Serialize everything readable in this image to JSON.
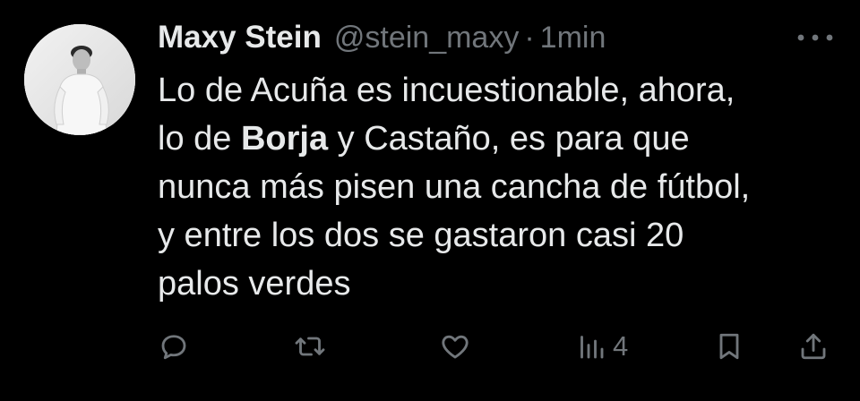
{
  "tweet": {
    "author_name": "Maxy Stein",
    "author_handle": "@stein_maxy",
    "separator": "·",
    "timestamp": "1min",
    "body": {
      "line1": "Lo de Acuña es incuestionable, ahora,",
      "line2_before": "lo de ",
      "line2_bold": "Borja",
      "line2_after": " y Castaño, es para que",
      "line3": "nunca más pisen una cancha de fútbol,",
      "line4": "y entre los dos se gastaron casi 20",
      "line5": "palos verdes"
    },
    "views_count": "4"
  },
  "icons": {
    "more": "more-horizontal-icon",
    "reply": "reply-icon",
    "retweet": "retweet-icon",
    "like": "heart-icon",
    "views": "views-icon",
    "bookmark": "bookmark-icon",
    "share": "share-icon"
  },
  "colors": {
    "background": "#000000",
    "text": "#e7e9ea",
    "secondary": "#71767b"
  }
}
